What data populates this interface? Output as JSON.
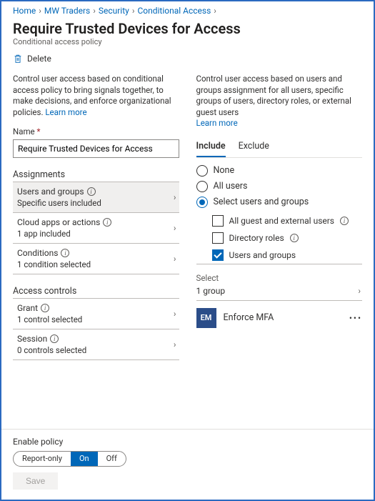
{
  "breadcrumb": [
    {
      "label": "Home"
    },
    {
      "label": "MW Traders"
    },
    {
      "label": "Security"
    },
    {
      "label": "Conditional Access"
    }
  ],
  "title": "Require Trusted Devices for Access",
  "subtitle": "Conditional access policy",
  "delete_label": "Delete",
  "left": {
    "desc": "Control user access based on conditional access policy to bring signals together, to make decisions, and enforce organizational policies.",
    "learn_more": "Learn more",
    "name_label": "Name",
    "name_value": "Require Trusted Devices for Access",
    "section_assignments": "Assignments",
    "section_access": "Access controls",
    "rows": {
      "users": {
        "label": "Users and groups",
        "sub": "Specific users included"
      },
      "apps": {
        "label": "Cloud apps or actions",
        "sub": "1 app included"
      },
      "conditions": {
        "label": "Conditions",
        "sub": "1 condition selected"
      },
      "grant": {
        "label": "Grant",
        "sub": "1 control selected"
      },
      "session": {
        "label": "Session",
        "sub": "0 controls selected"
      }
    }
  },
  "right": {
    "desc": "Control user access based on users and groups assignment for all users, specific groups of users, directory roles, or external guest users",
    "learn_more": "Learn more",
    "tabs": {
      "include": "Include",
      "exclude": "Exclude",
      "active": "include"
    },
    "radios": {
      "none": "None",
      "all": "All users",
      "select": "Select users and groups",
      "checked": "select"
    },
    "checks": {
      "guest": {
        "label": "All guest and external users",
        "checked": false,
        "info": true
      },
      "roles": {
        "label": "Directory roles",
        "checked": false,
        "info": true
      },
      "ug": {
        "label": "Users and groups",
        "checked": true,
        "info": false
      }
    },
    "select_label": "Select",
    "select_value": "1 group",
    "group": {
      "initials": "EM",
      "name": "Enforce MFA"
    }
  },
  "footer": {
    "enable_label": "Enable policy",
    "segments": {
      "report": "Report-only",
      "on": "On",
      "off": "Off",
      "active": "on"
    },
    "save": "Save"
  }
}
